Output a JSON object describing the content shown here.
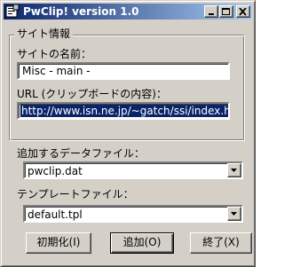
{
  "window": {
    "title": "PwClip! version 1.0",
    "minimize_label": "_",
    "maximize_label": "□",
    "close_label": "×"
  },
  "site_info": {
    "group_label": "サイト情報",
    "name_label": "サイトの名前：",
    "name_value": "Misc - main -",
    "url_label": "URL (クリップボードの内容)：",
    "url_value": "http://www.isn.ne.jp/~gatch/ssi/index.html"
  },
  "data_file": {
    "label": "追加するデータファイル：",
    "selected": "pwclip.dat"
  },
  "template_file": {
    "label": "テンプレートファイル：",
    "selected": "default.tpl"
  },
  "buttons": {
    "init": "初期化(I)",
    "add": "追加(O)",
    "exit": "終了(X)"
  }
}
